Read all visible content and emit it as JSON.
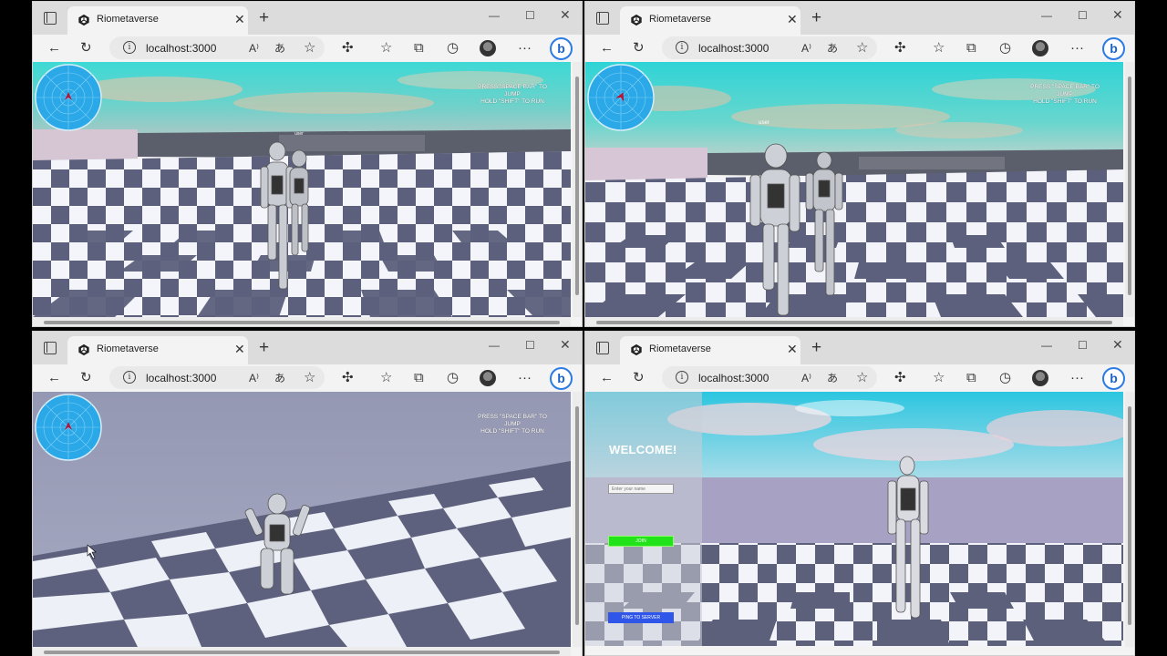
{
  "windows": [
    {
      "id": "top-left",
      "tab_title": "Riometaverse",
      "url": "localhost:3000",
      "hud_lines": [
        "PRESS \"SPACE BAR\" TO",
        "JUMP",
        "HOLD \"SHIFT\" TO RUN"
      ],
      "nametag": "user"
    },
    {
      "id": "top-right",
      "tab_title": "Riometaverse",
      "url": "localhost:3000",
      "hud_lines": [
        "PRESS \"SPACE BAR\" TO",
        "JUMP",
        "HOLD \"SHIFT\" TO RUN"
      ],
      "nametag": "user"
    },
    {
      "id": "bottom-left",
      "tab_title": "Riometaverse",
      "url": "localhost:3000",
      "hud_lines": [
        "PRESS \"SPACE BAR\" TO",
        "JUMP",
        "HOLD \"SHIFT\" TO RUN"
      ]
    },
    {
      "id": "bottom-right",
      "tab_title": "Riometaverse",
      "url": "localhost:3000",
      "welcome_title": "WELCOME!",
      "name_placeholder": "Enter your name",
      "join_label": "JOIN",
      "ping_label": "PING TO SERVER"
    }
  ],
  "icons": {
    "back": "back-arrow-icon",
    "refresh": "refresh-icon",
    "read_aloud": "read-aloud-icon",
    "translate": "translate-icon",
    "favorite_add": "add-favorite-icon",
    "extensions": "extensions-icon",
    "favorites": "favorites-icon",
    "collections": "collections-icon",
    "history": "history-icon",
    "profile": "profile-avatar",
    "more": "more-icon",
    "bing": "bing-icon"
  },
  "colors": {
    "minimap": "#2aa8e8",
    "join": "#22e21a",
    "ping": "#2f56e8"
  }
}
